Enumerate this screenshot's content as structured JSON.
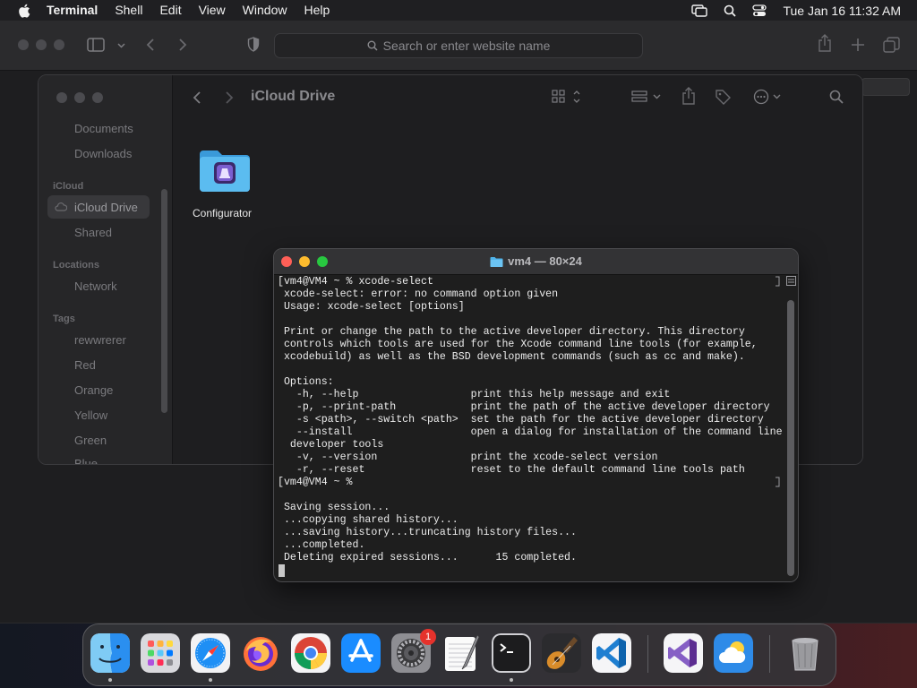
{
  "menubar": {
    "app_name": "Terminal",
    "menus": [
      "Shell",
      "Edit",
      "View",
      "Window",
      "Help"
    ],
    "clock": "Tue Jan 16  11:32 AM"
  },
  "safari": {
    "url_placeholder": "Search or enter website name"
  },
  "finder": {
    "title": "iCloud Drive",
    "favorites": [
      "Documents",
      "Downloads"
    ],
    "icloud_header": "iCloud",
    "icloud_items": [
      "iCloud Drive",
      "Shared"
    ],
    "locations_header": "Locations",
    "locations_items": [
      "Network"
    ],
    "tags_header": "Tags",
    "tags_items": [
      "rewwrerer",
      "Red",
      "Orange",
      "Yellow",
      "Green",
      "Blue"
    ],
    "folder_name": "Configurator"
  },
  "terminal": {
    "title": "vm4 — 80×24",
    "lines": [
      "[vm4@VM4 ~ % xcode-select",
      " xcode-select: error: no command option given",
      " Usage: xcode-select [options]",
      "",
      " Print or change the path to the active developer directory. This directory",
      " controls which tools are used for the Xcode command line tools (for example,",
      " xcodebuild) as well as the BSD development commands (such as cc and make).",
      "",
      " Options:",
      "   -h, --help                  print this help message and exit",
      "   -p, --print-path            print the path of the active developer directory",
      "   -s <path>, --switch <path>  set the path for the active developer directory",
      "   --install                   open a dialog for installation of the command line",
      "  developer tools",
      "   -v, --version               print the xcode-select version",
      "   -r, --reset                 reset to the default command line tools path",
      "[vm4@VM4 ~ %",
      "",
      " Saving session...",
      " ...copying shared history...",
      " ...saving history...truncating history files...",
      " ...completed.",
      " Deleting expired sessions...      15 completed."
    ]
  },
  "dock": {
    "apps": [
      {
        "name": "Finder",
        "icon": "finder-icon",
        "running": true
      },
      {
        "name": "Launchpad",
        "icon": "launchpad-icon",
        "running": false
      },
      {
        "name": "Safari",
        "icon": "safari-icon",
        "running": true
      },
      {
        "name": "Firefox",
        "icon": "firefox-icon",
        "running": false
      },
      {
        "name": "Chrome",
        "icon": "chrome-icon",
        "running": false
      },
      {
        "name": "App Store",
        "icon": "app-store-icon",
        "running": false
      },
      {
        "name": "System Settings",
        "icon": "system-settings-icon",
        "running": false,
        "badge": "1"
      },
      {
        "name": "TextEdit",
        "icon": "textedit-icon",
        "running": false
      },
      {
        "name": "Terminal",
        "icon": "terminal-icon",
        "running": true
      },
      {
        "name": "GarageBand",
        "icon": "garageband-icon",
        "running": false
      },
      {
        "name": "VS Code",
        "icon": "vscode-icon",
        "running": false
      },
      {
        "name": "Visual Studio",
        "icon": "visual-studio-icon",
        "running": false
      },
      {
        "name": "Weather",
        "icon": "weather-icon",
        "running": false
      },
      {
        "name": "Trash",
        "icon": "trash-icon",
        "running": false
      }
    ]
  },
  "colors": {
    "traffic_red": "#ff5f57",
    "traffic_yellow": "#febc2e",
    "traffic_green": "#28c840",
    "folder_blue": "#4fb3ea",
    "badge_red": "#e5322c"
  }
}
